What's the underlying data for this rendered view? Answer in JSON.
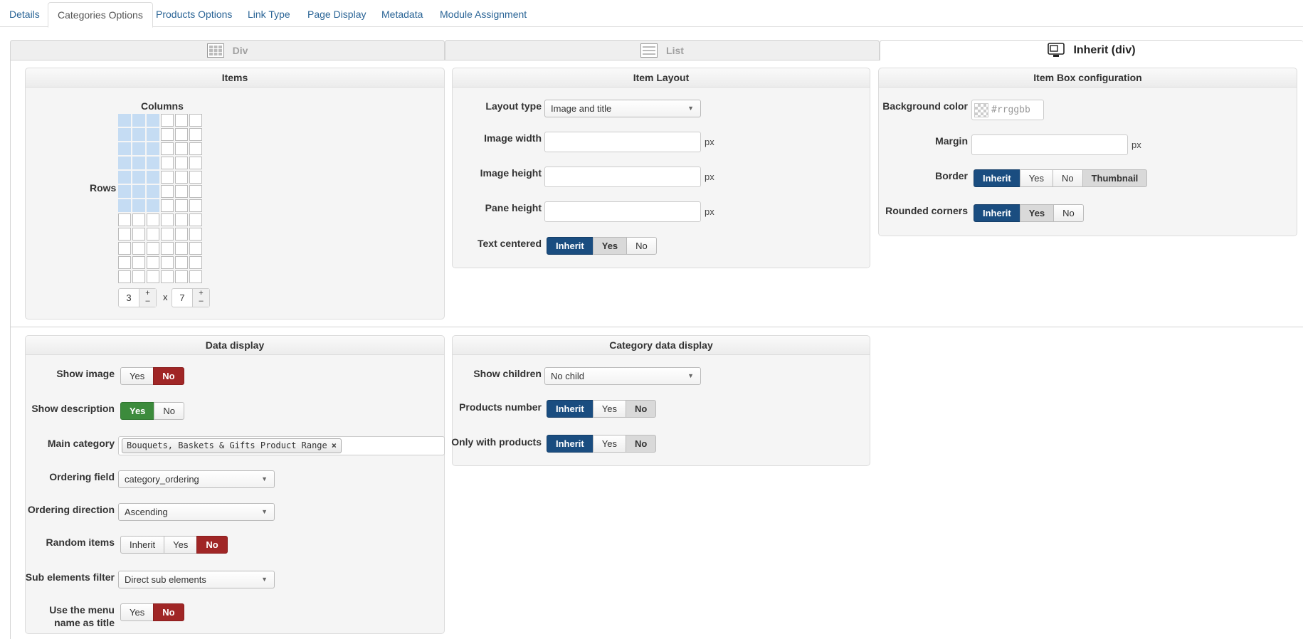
{
  "tabs": [
    "Details",
    "Categories Options",
    "Products Options",
    "Link Type",
    "Page Display",
    "Metadata",
    "Module Assignment"
  ],
  "layout_tabs": {
    "div": "Div",
    "list": "List",
    "inherit": "Inherit (div)"
  },
  "items": {
    "title": "Items",
    "columns_label": "Columns",
    "rows_label": "Rows",
    "columns_value": "3",
    "rows_value": "7",
    "times": "x",
    "grid_cols": 6,
    "grid_rows": 12
  },
  "item_layout": {
    "title": "Item Layout",
    "layout_type_label": "Layout type",
    "layout_type_value": "Image and title",
    "image_width_label": "Image width",
    "image_height_label": "Image height",
    "pane_height_label": "Pane height",
    "unit": "px",
    "text_centered_label": "Text centered",
    "text_centered_options": [
      "Inherit",
      "Yes",
      "No"
    ]
  },
  "item_box": {
    "title": "Item Box configuration",
    "bg_color_label": "Background color",
    "bg_color_placeholder": "#rrggbb",
    "margin_label": "Margin",
    "unit": "px",
    "border_label": "Border",
    "border_options": [
      "Inherit",
      "Yes",
      "No",
      "Thumbnail"
    ],
    "rounded_label": "Rounded corners",
    "rounded_options": [
      "Inherit",
      "Yes",
      "No"
    ]
  },
  "data_display": {
    "title": "Data display",
    "show_image_label": "Show image",
    "show_image_options": [
      "Yes",
      "No"
    ],
    "show_description_label": "Show description",
    "show_description_options": [
      "Yes",
      "No"
    ],
    "main_category_label": "Main category",
    "main_category_tag": "Bouquets, Baskets & Gifts Product Range",
    "ordering_field_label": "Ordering field",
    "ordering_field_value": "category_ordering",
    "ordering_direction_label": "Ordering direction",
    "ordering_direction_value": "Ascending",
    "random_items_label": "Random items",
    "random_items_options": [
      "Inherit",
      "Yes",
      "No"
    ],
    "sub_filter_label": "Sub elements filter",
    "sub_filter_value": "Direct sub elements",
    "menu_title_label_1": "Use the menu",
    "menu_title_label_2": "name as title",
    "menu_title_options": [
      "Yes",
      "No"
    ]
  },
  "category_data": {
    "title": "Category data display",
    "show_children_label": "Show children",
    "show_children_value": "No child",
    "products_number_label": "Products number",
    "products_number_options": [
      "Inherit",
      "Yes",
      "No"
    ],
    "only_with_products_label": "Only with products",
    "only_with_products_options": [
      "Inherit",
      "Yes",
      "No"
    ]
  },
  "colors": {
    "active_blue": "#1a4d80",
    "active_red": "#a02626",
    "active_green": "#3c8b3c",
    "grid_selected": "#c5dcf3",
    "link": "#2a6496"
  }
}
